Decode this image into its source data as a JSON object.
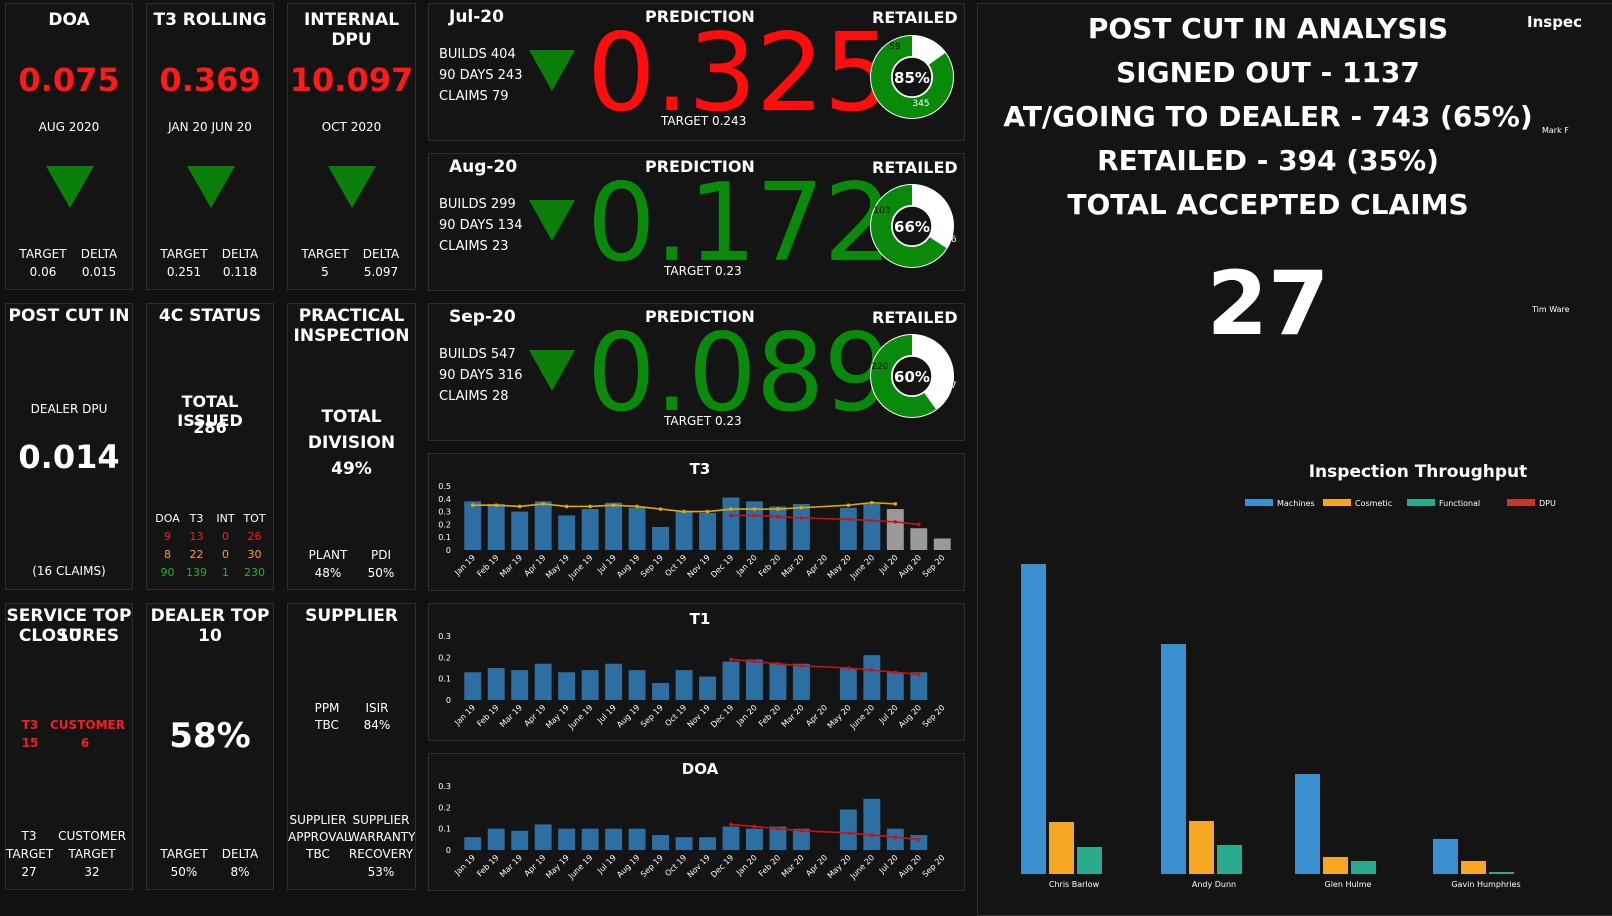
{
  "tiles": {
    "doa": {
      "title": "DOA",
      "value": "0.075",
      "period": "AUG 2020",
      "target_label": "TARGET",
      "delta_label": "DELTA",
      "target": "0.06",
      "delta": "0.015"
    },
    "t3": {
      "title": "T3 ROLLING",
      "value": "0.369",
      "period": "JAN 20 JUN 20",
      "target_label": "TARGET",
      "delta_label": "DELTA",
      "target": "0.251",
      "delta": "0.118"
    },
    "dpu": {
      "title": "INTERNAL DPU",
      "value": "10.097",
      "period": "OCT 2020",
      "target_label": "TARGET",
      "delta_label": "DELTA",
      "target": "5",
      "delta": "5.097"
    },
    "postcut": {
      "title": "POST CUT IN",
      "sub": "DEALER DPU",
      "value": "0.014",
      "claims": "(16 CLAIMS)"
    },
    "fourc": {
      "title": "4C STATUS",
      "issued_label": "TOTAL ISSUED",
      "issued": "286",
      "headers": [
        "DOA",
        "T3",
        "INT",
        "TOT"
      ],
      "rows": [
        [
          "9",
          "13",
          "0",
          "26"
        ],
        [
          "8",
          "22",
          "0",
          "30"
        ],
        [
          "90",
          "139",
          "1",
          "230"
        ]
      ]
    },
    "practical": {
      "title1": "PRACTICAL",
      "title2": "INSPECTION",
      "total1": "TOTAL",
      "total2": "DIVISION",
      "pct": "49%",
      "plant_label": "PLANT",
      "pdi_label": "PDI",
      "plant": "48%",
      "pdi": "50%"
    },
    "service": {
      "title1": "SERVICE TOP 10",
      "title2": "CLOSURES",
      "t3_label": "T3",
      "customer_label": "CUSTOMER",
      "t3": "15",
      "customer": "6",
      "t3_target_label1": "T3",
      "t3_target_label2": "TARGET",
      "cust_target_label1": "CUSTOMER",
      "cust_target_label2": "TARGET",
      "t3_target": "27",
      "cust_target": "32"
    },
    "dealer": {
      "title": "DEALER TOP 10",
      "pct": "58%",
      "target_label": "TARGET",
      "delta_label": "DELTA",
      "target": "50%",
      "delta": "8%"
    },
    "supplier": {
      "title": "SUPPLIER",
      "ppm_label": "PPM",
      "ppm": "TBC",
      "isir_label": "ISIR",
      "isir": "84%",
      "approval1": "SUPPLIER",
      "approval2": "APPROVAL",
      "approval": "TBC",
      "warranty1": "SUPPLIER",
      "warranty2": "WARRANTY",
      "warranty3": "RECOVERY",
      "warranty": "53%"
    }
  },
  "predictions": [
    {
      "month": "Jul-20",
      "pred_label": "PREDICTION",
      "ret_label": "RETAILED",
      "builds": "BUILDS 404",
      "days": "90 DAYS 243",
      "claims": "CLAIMS 79",
      "value": "0.325",
      "value_color": "#ff0d0d",
      "target": "TARGET 0.243",
      "donut_pct": "85%",
      "donut_small": "59",
      "donut_big": "345",
      "fill_fraction": 0.85
    },
    {
      "month": "Aug-20",
      "pred_label": "PREDICTION",
      "ret_label": "RETAILED",
      "builds": "BUILDS 299",
      "days": "90 DAYS 134",
      "claims": "CLAIMS 23",
      "value": "0.172",
      "value_color": "#0a8a0a",
      "target": "TARGET 0.23",
      "donut_pct": "66%",
      "donut_small": "103",
      "donut_big": "196",
      "fill_fraction": 0.66
    },
    {
      "month": "Sep-20",
      "pred_label": "PREDICTION",
      "ret_label": "RETAILED",
      "builds": "BUILDS 547",
      "days": "90 DAYS 316",
      "claims": "CLAIMS 28",
      "value": "0.089",
      "value_color": "#0a8a0a",
      "target": "TARGET 0.23",
      "donut_pct": "60%",
      "donut_small": "220",
      "donut_big": "327",
      "fill_fraction": 0.6
    }
  ],
  "analysis": {
    "line1": "POST CUT IN ANALYSIS",
    "line2": "SIGNED OUT - 1137",
    "line3": "AT/GOING TO DEALER - 743 (65%)",
    "line4": "RETAILED - 394 (35%)",
    "line5": "TOTAL ACCEPTED CLAIMS",
    "big": "27",
    "edge_title": "Inspec",
    "edge_name1": "Mark F",
    "edge_name2": "Tim Ware"
  },
  "colors": {
    "bar": "#2e6fa3",
    "bar_grey": "#9a9a9a",
    "line_yellow": "#e0a800",
    "line_red": "#d01010"
  },
  "chart_data": [
    {
      "type": "bar",
      "title": "T3",
      "categories": [
        "Jan 19",
        "Feb 19",
        "Mar 19",
        "Apr 19",
        "May 19",
        "June 19",
        "Jul 19",
        "Aug 19",
        "Sep 19",
        "Oct 19",
        "Nov 19",
        "Dec 19",
        "Jan 20",
        "Feb 20",
        "Mar 20",
        "Apr 20",
        "May 20",
        "June 20",
        "Jul 20",
        "Aug 20",
        "Sep 20"
      ],
      "values": [
        0.38,
        0.36,
        0.3,
        0.38,
        0.27,
        0.32,
        0.37,
        0.33,
        0.18,
        0.3,
        0.29,
        0.41,
        0.38,
        0.34,
        0.36,
        null,
        0.33,
        0.36,
        0.32,
        0.17,
        0.09
      ],
      "grey_from_index": 18,
      "line_yellow": [
        0.35,
        0.35,
        0.34,
        0.36,
        0.34,
        0.34,
        0.35,
        0.34,
        0.32,
        0.3,
        0.3,
        0.32,
        0.32,
        0.32,
        0.33,
        null,
        0.35,
        0.37,
        0.36,
        null,
        null
      ],
      "line_red": [
        null,
        null,
        null,
        null,
        null,
        null,
        null,
        null,
        null,
        null,
        null,
        0.27,
        0.27,
        0.26,
        0.25,
        null,
        0.24,
        0.23,
        0.22,
        0.2,
        null
      ],
      "ylim": [
        0,
        0.5
      ],
      "yticks": [
        "0",
        "0.1",
        "0.2",
        "0.3",
        "0.4",
        "0.5"
      ],
      "ytick_values": [
        0,
        0.1,
        0.2,
        0.3,
        0.4,
        0.5
      ]
    },
    {
      "type": "bar",
      "title": "T1",
      "categories": [
        "Jan 19",
        "Feb 19",
        "Mar 19",
        "Apr 19",
        "May 19",
        "June 19",
        "Jul 19",
        "Aug 19",
        "Sep 19",
        "Oct 19",
        "Nov 19",
        "Dec 19",
        "Jan 20",
        "Feb 20",
        "Mar 20",
        "Apr 20",
        "May 20",
        "June 20",
        "Jul 20",
        "Aug 20",
        "Sep 20"
      ],
      "values": [
        0.13,
        0.15,
        0.14,
        0.17,
        0.13,
        0.14,
        0.17,
        0.14,
        0.08,
        0.14,
        0.11,
        0.18,
        0.19,
        0.17,
        0.17,
        null,
        0.15,
        0.21,
        0.13,
        0.13,
        null
      ],
      "line_red": [
        null,
        null,
        null,
        null,
        null,
        null,
        null,
        null,
        null,
        null,
        null,
        0.19,
        0.18,
        0.17,
        0.16,
        null,
        0.15,
        0.14,
        0.13,
        0.12,
        null
      ],
      "ylim": [
        0,
        0.3
      ],
      "yticks": [
        "0",
        "0.1",
        "0.2",
        "0.3"
      ],
      "ytick_values": [
        0,
        0.1,
        0.2,
        0.3
      ]
    },
    {
      "type": "bar",
      "title": "DOA",
      "categories": [
        "Jan 19",
        "Feb 19",
        "Mar 19",
        "Apr 19",
        "May 19",
        "June 19",
        "Jul 19",
        "Aug 19",
        "Sep 19",
        "Oct 19",
        "Nov 19",
        "Dec 19",
        "Jan 20",
        "Feb 20",
        "Mar 20",
        "Apr 20",
        "May 20",
        "June 20",
        "Jul 20",
        "Aug 20",
        "Sep 20"
      ],
      "values": [
        0.06,
        0.1,
        0.09,
        0.12,
        0.1,
        0.1,
        0.1,
        0.1,
        0.07,
        0.06,
        0.06,
        0.11,
        0.1,
        0.11,
        0.1,
        null,
        0.19,
        0.24,
        0.1,
        0.07,
        null
      ],
      "line_red": [
        null,
        null,
        null,
        null,
        null,
        null,
        null,
        null,
        null,
        null,
        null,
        0.12,
        0.11,
        0.1,
        0.09,
        null,
        0.08,
        0.07,
        0.06,
        0.05,
        null
      ],
      "ylim": [
        0,
        0.3
      ],
      "yticks": [
        "0",
        "0.1",
        "0.2",
        "0.3"
      ],
      "ytick_values": [
        0,
        0.1,
        0.2,
        0.3
      ]
    },
    {
      "type": "bar",
      "title": "Inspection Throughput",
      "categories": [
        "Chris Barlow",
        "Andy Dunn",
        "Glen Hulme",
        "Gavin Humphries"
      ],
      "series": [
        {
          "name": "Machines",
          "color": "#3a8fd0",
          "values": [
            310,
            230,
            100,
            35
          ]
        },
        {
          "name": "Cosmetic",
          "color": "#f5a623",
          "values": [
            52,
            53,
            17,
            13
          ]
        },
        {
          "name": "Functional",
          "color": "#2aab8e",
          "values": [
            27,
            29,
            13,
            2
          ]
        },
        {
          "name": "DPU",
          "color": "#c0392b",
          "values": [
            0,
            0,
            0,
            0
          ]
        }
      ],
      "ylim": [
        0,
        320
      ]
    }
  ]
}
